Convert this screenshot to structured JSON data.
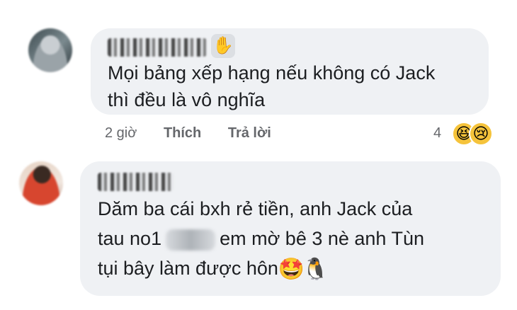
{
  "comments": [
    {
      "author_icon": "wave-hand-emoji",
      "text_line1": "Mọi bảng xếp hạng nếu không có Jack",
      "text_line2": "thì đều là vô nghĩa",
      "time": "2 giờ",
      "like_label": "Thích",
      "reply_label": "Trả lời",
      "reaction_count": "4",
      "reactions": [
        "laughing-emoji",
        "sad-emoji"
      ]
    },
    {
      "text_line1": "Dăm ba cái bxh rẻ tiền, anh Jack của",
      "text_line2a": "tau no1",
      "text_line2b": "em mờ bê 3 nè anh Tùn",
      "text_line3": "tụi bây làm được hôn",
      "end_emojis": [
        "star-struck-emoji",
        "penguin-emoji"
      ]
    }
  ],
  "colors": {
    "bubble": "#eff1f4",
    "text": "#1c1e21",
    "meta": "#65676b"
  }
}
